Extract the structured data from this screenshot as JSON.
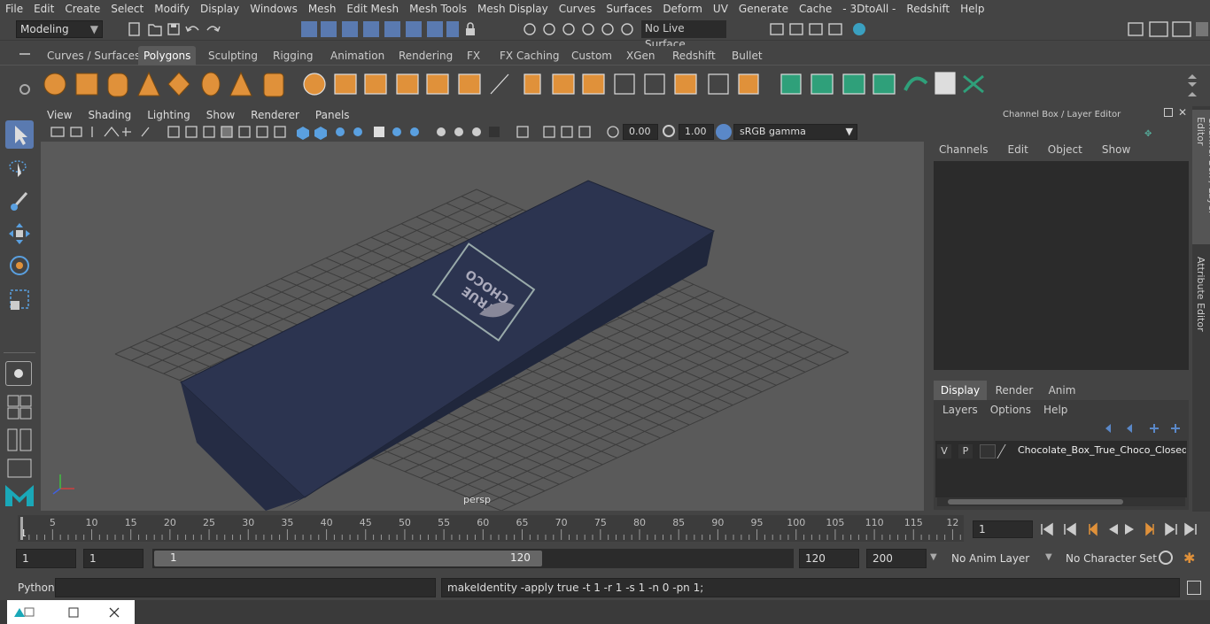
{
  "menubar": {
    "items": [
      "File",
      "Edit",
      "Create",
      "Select",
      "Modify",
      "Display",
      "Windows",
      "Mesh",
      "Edit Mesh",
      "Mesh Tools",
      "Mesh Display",
      "Curves",
      "Surfaces",
      "Deform",
      "UV",
      "Generate",
      "Cache",
      "- 3DtoAll -",
      "Redshift",
      "Help"
    ]
  },
  "status": {
    "mode": "Modeling",
    "live_surface": "No Live Surface"
  },
  "shelf": {
    "tabs": [
      "Curves / Surfaces",
      "Polygons",
      "Sculpting",
      "Rigging",
      "Animation",
      "Rendering",
      "FX",
      "FX Caching",
      "Custom",
      "XGen",
      "Redshift",
      "Bullet"
    ],
    "active_tab": "Polygons"
  },
  "panel": {
    "menu": [
      "View",
      "Shading",
      "Lighting",
      "Show",
      "Renderer",
      "Panels"
    ],
    "exposure": "0.00",
    "gamma": "1.00",
    "color_space": "sRGB gamma",
    "camera_label": "persp"
  },
  "object": {
    "label_line1": "TRUE",
    "label_line2": "CHOCO"
  },
  "channel_box": {
    "title": "Channel Box / Layer Editor",
    "menu": [
      "Channels",
      "Edit",
      "Object",
      "Show"
    ],
    "layer_tabs": [
      "Display",
      "Render",
      "Anim"
    ],
    "active_layer_tab": "Display",
    "layer_menu": [
      "Layers",
      "Options",
      "Help"
    ],
    "layer": {
      "v": "V",
      "p": "P",
      "name": "Chocolate_Box_True_Choco_Closed_C"
    }
  },
  "side_tabs": [
    "Channel Box / Layer Editor",
    "Attribute Editor"
  ],
  "timeline": {
    "ticks": [
      "5",
      "10",
      "15",
      "20",
      "25",
      "30",
      "35",
      "40",
      "45",
      "50",
      "55",
      "60",
      "65",
      "70",
      "75",
      "80",
      "85",
      "90",
      "95",
      "100",
      "105",
      "110",
      "115",
      "12"
    ],
    "start_marker": "1",
    "current_frame": "1"
  },
  "range": {
    "start": "1",
    "anim_start": "1",
    "slider_start": "1",
    "slider_end": "120",
    "end": "120",
    "anim_end": "200",
    "anim_layer": "No Anim Layer",
    "character_set": "No Character Set"
  },
  "command": {
    "language": "Python",
    "output": "makeIdentity -apply true -t 1 -r 1 -s 1 -n 0 -pn 1;"
  },
  "colors": {
    "accent": "#5a88c8",
    "box": "#2c3450",
    "grid": "#3c3c3c",
    "viewport": "#5a5a5a"
  }
}
